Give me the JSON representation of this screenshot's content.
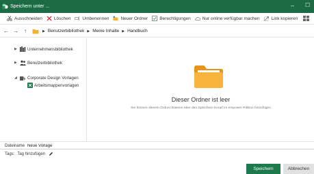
{
  "window": {
    "title": "Speichern unter ...",
    "app_icon": "sharepoint-logo-icon"
  },
  "toolbar": {
    "items": [
      {
        "label": "Ausschneiden",
        "icon": "scissors-icon"
      },
      {
        "label": "Löschen",
        "icon": "delete-x-icon"
      },
      {
        "label": "Umbenennen",
        "icon": "rename-icon"
      },
      {
        "label": "Neuer Ordner",
        "icon": "new-folder-icon"
      },
      {
        "label": "Berechtigungen",
        "icon": "permissions-icon"
      },
      {
        "label": "Nur online verfügbar machen",
        "icon": "cloud-icon"
      },
      {
        "label": "Link kopieren",
        "icon": "link-icon"
      }
    ]
  },
  "breadcrumb": {
    "items": [
      "Benutzerbibliothek",
      "Meine Inhalte",
      "Handbuch"
    ]
  },
  "sidebar": {
    "items": [
      {
        "label": "Unternehmensbibliothek",
        "icon": "library-icon"
      },
      {
        "label": "Benutzerbibliothek",
        "icon": "users-icon"
      },
      {
        "label": "Corporate Design Vorlagen",
        "icon": "design-library-icon"
      },
      {
        "label": "Arbeitsmappenvorlagen",
        "icon": "excel-icon"
      }
    ]
  },
  "main": {
    "empty_title": "Dieser Ordner ist leer",
    "empty_subtitle": "Sie können diesem Ordner Dateien über den Speichern Knopf im empower Ribbon hinzufügen"
  },
  "footer": {
    "filename_label": "Dateiname",
    "filename_value": "Neue Vorlage",
    "tags_label": "Tags:",
    "tags_value": "Tag hinzufügen",
    "save_label": "Speichern",
    "cancel_label": "Abbrechen"
  },
  "colors": {
    "accent": "#1d6b44",
    "primary_button": "#1d7a4c",
    "folder": "#f5a623"
  }
}
